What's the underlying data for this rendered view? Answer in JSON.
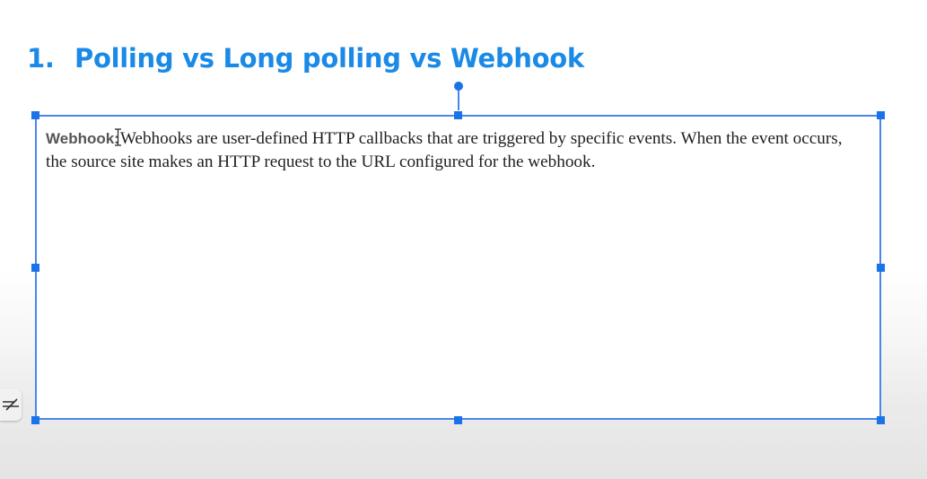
{
  "slide": {
    "title_number": "1.",
    "title_text": "Polling vs Long polling vs Webhook"
  },
  "textbox": {
    "term": "Webhook:",
    "body": "Webhooks are user-defined HTTP callbacks that are triggered by specific events. When the event occurs, the source site makes an HTTP request to the URL configured for the webhook."
  },
  "icons": {
    "text_cursor": "i-beam-cursor-icon",
    "side_tool": "strikethrough-icon"
  },
  "colors": {
    "title": "#1a8ae6",
    "selection": "#4a86e8",
    "handle": "#1a73e8"
  }
}
